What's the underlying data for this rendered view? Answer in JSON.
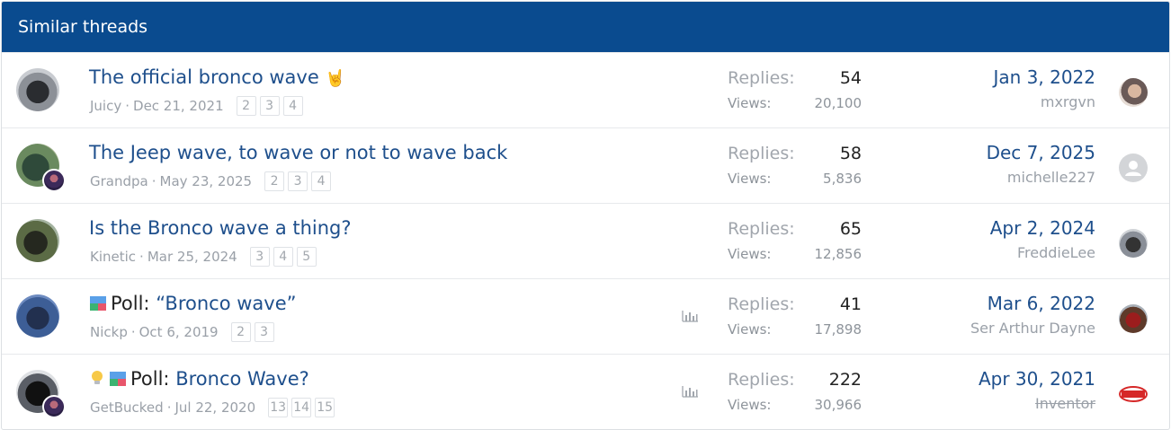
{
  "block": {
    "title": "Similar threads"
  },
  "threads": [
    {
      "title": "The official bronco wave",
      "title_emoji": "🤘",
      "prefix": "",
      "author": "Juicy",
      "start_date": "Dec 21, 2021",
      "pages": [
        "2",
        "3",
        "4"
      ],
      "replies_label": "Replies:",
      "replies": "54",
      "views_label": "Views:",
      "views": "20,100",
      "last_date": "Jan 3, 2022",
      "last_user": "mxrgvn"
    },
    {
      "title": "The Jeep wave, to wave or not to wave back",
      "title_emoji": "",
      "prefix": "",
      "author": "Grandpa",
      "start_date": "May 23, 2025",
      "pages": [
        "2",
        "3",
        "4"
      ],
      "replies_label": "Replies:",
      "replies": "58",
      "views_label": "Views:",
      "views": "5,836",
      "last_date": "Dec 7, 2025",
      "last_user": "michelle227"
    },
    {
      "title": "Is the Bronco wave a thing?",
      "title_emoji": "",
      "prefix": "",
      "author": "Kinetic",
      "start_date": "Mar 25, 2024",
      "pages": [
        "3",
        "4",
        "5"
      ],
      "replies_label": "Replies:",
      "replies": "65",
      "views_label": "Views:",
      "views": "12,856",
      "last_date": "Apr 2, 2024",
      "last_user": "FreddieLee"
    },
    {
      "title": "“Bronco wave”",
      "title_emoji": "",
      "prefix": "Poll:",
      "author": "Nickp",
      "start_date": "Oct 6, 2019",
      "pages": [
        "2",
        "3"
      ],
      "replies_label": "Replies:",
      "replies": "41",
      "views_label": "Views:",
      "views": "17,898",
      "last_date": "Mar 6, 2022",
      "last_user": "Ser Arthur Dayne"
    },
    {
      "title": "Bronco Wave?",
      "title_emoji": "",
      "prefix": "Poll:",
      "author": "GetBucked",
      "start_date": "Jul 22, 2020",
      "pages": [
        "13",
        "14",
        "15"
      ],
      "replies_label": "Replies:",
      "replies": "222",
      "views_label": "Views:",
      "views": "30,966",
      "last_date": "Apr 30, 2021",
      "last_user": "Inventor"
    }
  ],
  "colors": {
    "header_bg": "#0a4b8f",
    "link": "#1e4f8c",
    "muted": "#9aa0a8"
  }
}
